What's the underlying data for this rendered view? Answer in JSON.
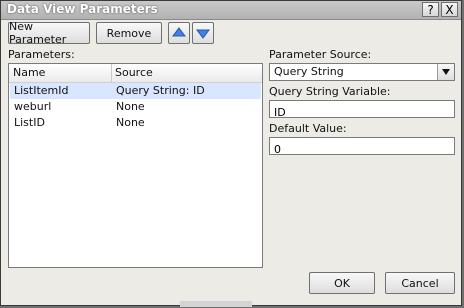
{
  "window": {
    "title": "Data View Parameters",
    "help_glyph": "?",
    "close_glyph": "X"
  },
  "toolbar": {
    "new_parameter_label": "New Parameter",
    "remove_label": "Remove",
    "move_up_icon": "up-arrow-icon",
    "move_down_icon": "down-arrow-icon"
  },
  "parameters": {
    "label": "Parameters:",
    "columns": [
      "Name",
      "Source"
    ],
    "rows": [
      {
        "name": "ListItemId",
        "source": "Query String: ID",
        "selected": true
      },
      {
        "name": "weburl",
        "source": "None",
        "selected": false
      },
      {
        "name": "ListID",
        "source": "None",
        "selected": false
      }
    ]
  },
  "right_panel": {
    "parameter_source_label": "Parameter Source:",
    "parameter_source_value": "Query String",
    "query_string_variable_label": "Query String Variable:",
    "query_string_variable_value": "ID",
    "default_value_label": "Default Value:",
    "default_value_value": "0"
  },
  "buttons": {
    "ok_label": "OK",
    "cancel_label": "Cancel"
  }
}
